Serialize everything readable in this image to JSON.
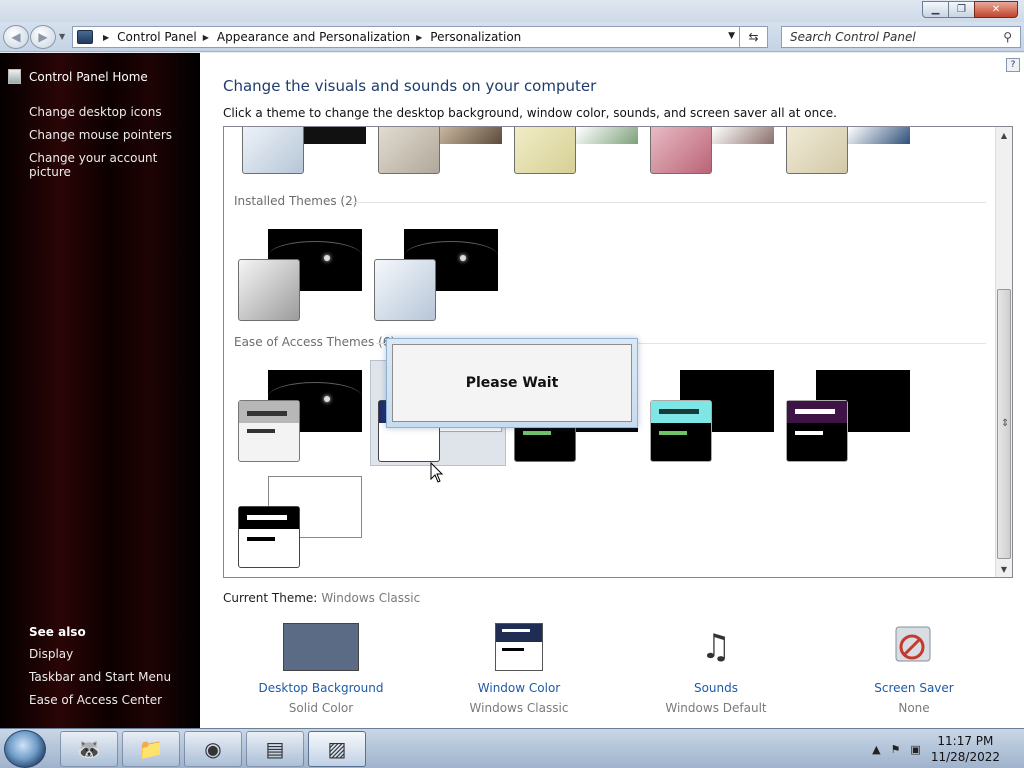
{
  "address": {
    "crumbs": [
      "Control Panel",
      "Appearance and Personalization",
      "Personalization"
    ],
    "search_placeholder": "Search Control Panel"
  },
  "left": {
    "home": "Control Panel Home",
    "tasks": [
      "Change desktop icons",
      "Change mouse pointers",
      "Change your account picture"
    ],
    "see_also_title": "See also",
    "see_also": [
      "Display",
      "Taskbar and Start Menu",
      "Ease of Access Center"
    ]
  },
  "main": {
    "heading": "Change the visuals and sounds on your computer",
    "subheading": "Click a theme to change the desktop background, window color, sounds, and screen saver all at once.",
    "installed_title": "Installed Themes (2)",
    "ease_title": "Ease of Access Themes (6)",
    "dialog_text": "Please Wait",
    "current_label": "Current Theme:",
    "current_value": "Windows Classic"
  },
  "settings": [
    {
      "label": "Desktop Background",
      "value": "Solid Color",
      "icon": "desktop-background-icon"
    },
    {
      "label": "Window Color",
      "value": "Windows Classic",
      "icon": "window-color-icon"
    },
    {
      "label": "Sounds",
      "value": "Windows Default",
      "icon": "sounds-icon"
    },
    {
      "label": "Screen Saver",
      "value": "None",
      "icon": "screen-saver-icon"
    }
  ],
  "taskbar": {
    "time": "11:17 PM",
    "date": "11/28/2022"
  },
  "colors": {
    "heading": "#1e3d6b",
    "link": "#1e5aa8",
    "muted": "#7a7a7a"
  }
}
